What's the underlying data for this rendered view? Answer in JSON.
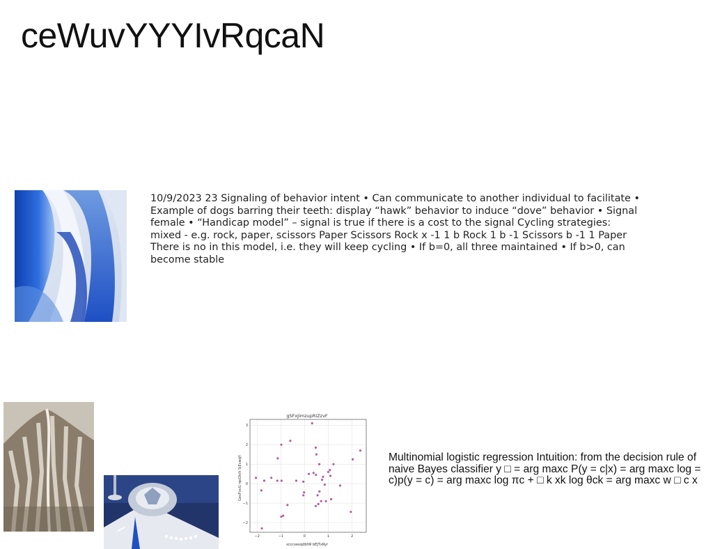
{
  "page": {
    "title": "ceWuvYYYIvRqcaN"
  },
  "images": {
    "abstract": "abstract-blue-waves-image",
    "mountain": "snowy-mountain-image",
    "table": "blue-table-setting-image"
  },
  "slides": {
    "text1": "10/9/2023 23 Signaling of behavior intent • Can communicate to another individual to facilitate • Example of dogs barring their teeth: display “hawk” behavior to induce “dove” behavior • Signal female • “Handicap model” – signal is true if there is a cost to the signal Cycling strategies: mixed - e.g. rock, paper, scissors Paper Scissors Rock x -1 1 b Rock 1 b -1 Scissors b -1 1 Paper There is no in this model, i.e. they will keep cycling • If b=0, all three maintained • If b>0, can become stable",
    "text2": "Multinomial logistic regression Intuition: from the decision rule of naive Bayes classifier y □ = arg maxc P(y = c|x) = arg maxc log = c)p(y = c) = arg maxc log πc + □ k xk log θck = arg maxc w □ c x"
  },
  "chart_data": {
    "type": "scatter",
    "title": "gSFxJimzupRiZzvF",
    "xlabel": "xcccvexqdbtW bEJTxRyr",
    "ylabel": "GevFxvG rqcDkih SiEvwqY",
    "xlim": [
      -2.3,
      2.6
    ],
    "ylim": [
      -2.5,
      3.3
    ],
    "x_ticks": [
      -2,
      -1,
      0,
      1,
      2
    ],
    "y_ticks": [
      -2,
      -1,
      0,
      1,
      2,
      3
    ],
    "grid": true,
    "color": "#b0609c",
    "x": [
      0.32,
      0.47,
      0.5,
      -0.6,
      -0.98,
      -1.13,
      -0.35,
      -2.05,
      -1.7,
      -1.4,
      -1.15,
      -0.97,
      -1.82,
      -0.05,
      -0.02,
      0.18,
      0.48,
      0.62,
      0.78,
      0.85,
      1.0,
      1.07,
      1.22,
      1.12,
      0.58,
      0.7,
      0.74,
      0.63,
      0.47,
      1.95,
      1.09,
      -0.98,
      -1.8,
      -0.9,
      -0.72,
      -0.05,
      0.38,
      0.55,
      0.9,
      1.5,
      2.03,
      2.35
    ],
    "y": [
      3.1,
      1.85,
      1.5,
      2.2,
      2.0,
      1.3,
      0.15,
      0.3,
      0.15,
      0.3,
      0.15,
      0.15,
      -0.35,
      0.1,
      -0.45,
      0.5,
      0.45,
      1.0,
      0.35,
      -0.05,
      0.6,
      0.7,
      1.0,
      -0.8,
      -1.05,
      -0.9,
      0.2,
      -0.4,
      -1.15,
      -1.45,
      0.4,
      -1.7,
      -2.3,
      -1.65,
      -1.1,
      -0.6,
      0.55,
      -0.6,
      -0.9,
      -0.1,
      1.25,
      1.7
    ]
  }
}
